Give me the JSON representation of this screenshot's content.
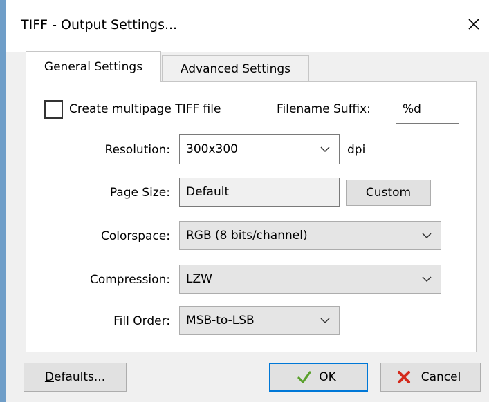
{
  "window": {
    "title": "TIFF - Output Settings..."
  },
  "tabs": [
    {
      "label": "General Settings",
      "selected": true
    },
    {
      "label": "Advanced Settings",
      "selected": false
    }
  ],
  "multipage": {
    "label": "Create multipage TIFF file",
    "checked": false
  },
  "filename_suffix": {
    "label": "Filename Suffix:",
    "value": "%d"
  },
  "resolution": {
    "label": "Resolution:",
    "value": "300x300",
    "unit": "dpi"
  },
  "page_size": {
    "label": "Page Size:",
    "value": "Default",
    "button": "Custom"
  },
  "colorspace": {
    "label": "Colorspace:",
    "value": "RGB (8 bits/channel)"
  },
  "compression": {
    "label": "Compression:",
    "value": "LZW"
  },
  "fill_order": {
    "label": "Fill Order:",
    "value": "MSB-to-LSB"
  },
  "buttons": {
    "defaults": "Defaults...",
    "ok": "OK",
    "cancel": "Cancel"
  },
  "colors": {
    "accent": "#0078d7",
    "title_bar": "#ffffff",
    "ok_check": "#5aa02c",
    "cancel_x": "#d42a1c"
  },
  "icons": {
    "close": "close-icon",
    "ok": "check-icon",
    "cancel": "x-icon",
    "dropdown": "chevron-down-icon"
  }
}
